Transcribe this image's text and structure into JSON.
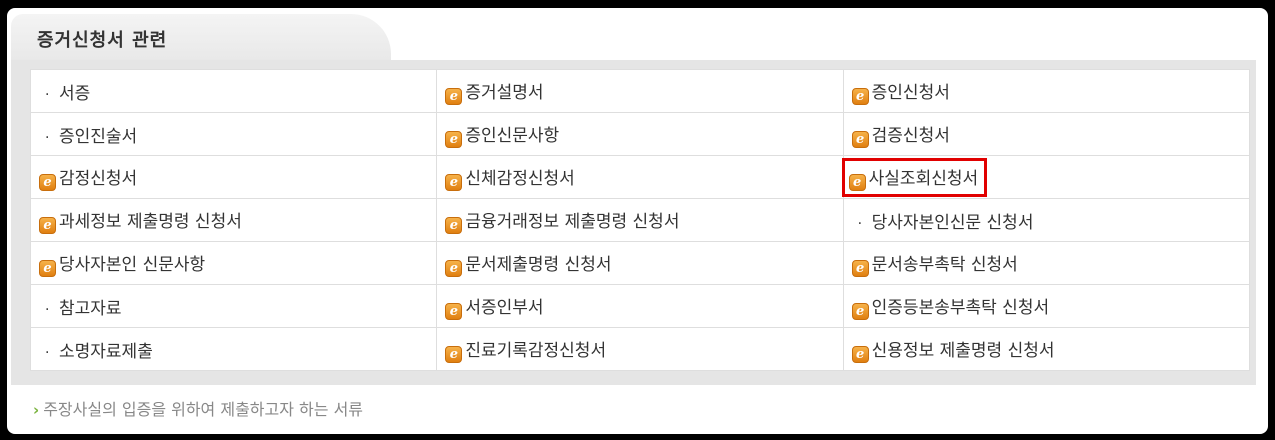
{
  "section": {
    "title": "증거신청서 관련"
  },
  "rows": [
    [
      {
        "label": "서증",
        "icon": "bullet"
      },
      {
        "label": "증거설명서",
        "icon": "e-icon"
      },
      {
        "label": "증인신청서",
        "icon": "e-icon"
      }
    ],
    [
      {
        "label": "증인진술서",
        "icon": "bullet"
      },
      {
        "label": "증인신문사항",
        "icon": "e-icon"
      },
      {
        "label": "검증신청서",
        "icon": "e-icon"
      }
    ],
    [
      {
        "label": "감정신청서",
        "icon": "e-icon"
      },
      {
        "label": "신체감정신청서",
        "icon": "e-icon"
      },
      {
        "label": "사실조회신청서",
        "icon": "e-icon",
        "highlighted": true
      }
    ],
    [
      {
        "label": "과세정보 제출명령 신청서",
        "icon": "e-icon"
      },
      {
        "label": "금융거래정보 제출명령 신청서",
        "icon": "e-icon"
      },
      {
        "label": "당사자본인신문 신청서",
        "icon": "bullet"
      }
    ],
    [
      {
        "label": "당사자본인 신문사항",
        "icon": "e-icon"
      },
      {
        "label": "문서제출명령 신청서",
        "icon": "e-icon"
      },
      {
        "label": "문서송부촉탁 신청서",
        "icon": "e-icon"
      }
    ],
    [
      {
        "label": "참고자료",
        "icon": "bullet"
      },
      {
        "label": "서증인부서",
        "icon": "e-icon"
      },
      {
        "label": "인증등본송부촉탁 신청서",
        "icon": "e-icon"
      }
    ],
    [
      {
        "label": "소명자료제출",
        "icon": "bullet"
      },
      {
        "label": "진료기록감정신청서",
        "icon": "e-icon"
      },
      {
        "label": "신용정보 제출명령 신청서",
        "icon": "e-icon"
      }
    ]
  ],
  "footer": {
    "text": "주장사실의 입증을 위하여 제출하고자 하는 서류"
  },
  "colors": {
    "accent_icon": "#f0951f",
    "highlight": "#e10000",
    "footer_arrow": "#7ab33e"
  }
}
